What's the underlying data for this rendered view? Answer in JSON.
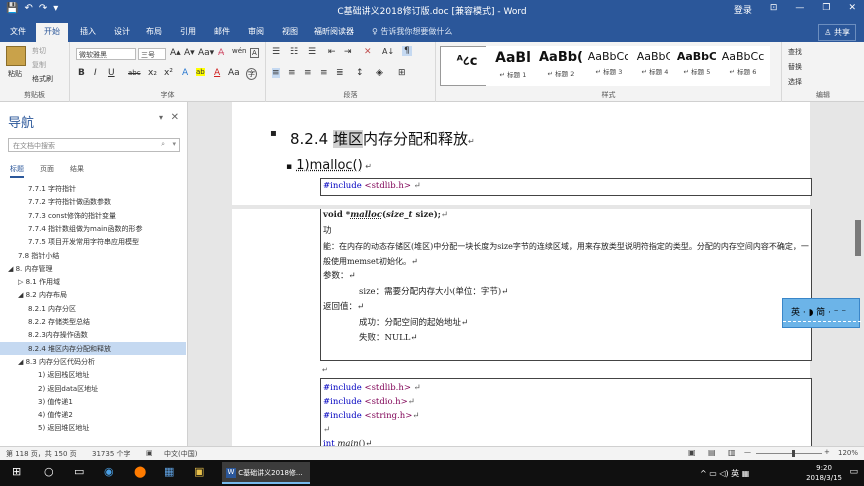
{
  "window": {
    "title": "C基础讲义2018修订版.doc [兼容模式] - Word",
    "login": "登录",
    "controls": {
      "restore_ribbon": "⊡",
      "minimize": "—",
      "maximize": "❐",
      "close": "✕"
    },
    "qat": {
      "save": "💾",
      "undo": "↶",
      "redo": "↷",
      "customize": "▾"
    }
  },
  "ribbon_tabs": [
    "文件",
    "开始",
    "插入",
    "设计",
    "布局",
    "引用",
    "邮件",
    "审阅",
    "视图",
    "福昕阅读器"
  ],
  "active_tab": "开始",
  "tell_me": "♀ 告诉我你想要做什么",
  "share": "♙ 共享",
  "ribbon": {
    "clipboard": {
      "label": "剪贴板",
      "paste": "粘贴",
      "cut": "剪切",
      "copy": "复制",
      "format_painter": "格式刷"
    },
    "font": {
      "label": "字体",
      "font_name": "微软雅黑",
      "font_size": "三号",
      "grow": "A▴",
      "shrink": "A▾",
      "case": "Aa▾",
      "clear": "A̶",
      "wen": "wén",
      "border_a": "A",
      "bold": "B",
      "italic": "I",
      "underline": "U",
      "strike": "abc",
      "sub": "x₂",
      "sup": "x²",
      "effects": "A",
      "highlight": "ab",
      "color": "A",
      "aa": "Aa",
      "circle": "字"
    },
    "paragraph": {
      "label": "段落",
      "bullets": "☰",
      "numbering": "☷",
      "multilevel": "☰",
      "dec_indent": "⇤",
      "inc_indent": "⇥",
      "chinese_layout": "✕",
      "sort": "A↓",
      "marks": "¶",
      "align_left": "≡",
      "center": "≡",
      "align_right": "≡",
      "justify": "≡",
      "distributed": "≣",
      "line_spacing": "↕",
      "shading": "◈",
      "borders": "⊞"
    },
    "styles": {
      "label": "样式",
      "items": [
        {
          "preview": "ᴬ८ᴄ",
          "name": ""
        },
        {
          "preview": "AaBl",
          "name": "↵ 标题 1"
        },
        {
          "preview": "AaBb(",
          "name": "↵ 标题 2"
        },
        {
          "preview": "AaBbCc",
          "name": "↵ 标题 3"
        },
        {
          "preview": "AaBbC",
          "name": "↵ 标题 4"
        },
        {
          "preview": "AaBbC",
          "name": "↵ 标题 5"
        },
        {
          "preview": "AaBbCc",
          "name": "↵ 标题 6"
        }
      ]
    },
    "editing": {
      "label": "编辑",
      "find": "查找",
      "replace": "替换",
      "select": "选择"
    }
  },
  "nav": {
    "title": "导航",
    "search_placeholder": "在文档中搜索",
    "tabs": [
      "标题",
      "页面",
      "结果"
    ],
    "items": [
      {
        "text": "7.7.1 字符指针",
        "indent": 3
      },
      {
        "text": "7.7.2 字符指针做函数参数",
        "indent": 3
      },
      {
        "text": "7.7.3 const修饰的指针变量",
        "indent": 3
      },
      {
        "text": "7.7.4 指针数组做为main函数的形参",
        "indent": 3
      },
      {
        "text": "7.7.5 项目开发常用字符串应用模型",
        "indent": 3
      },
      {
        "text": "7.8 指针小结",
        "indent": 2
      },
      {
        "text": "◢ 8. 内存管理",
        "indent": 1
      },
      {
        "text": "▷ 8.1 作用域",
        "indent": 2
      },
      {
        "text": "◢ 8.2 内存布局",
        "indent": 2
      },
      {
        "text": "8.2.1 内存分区",
        "indent": 3
      },
      {
        "text": "8.2.2 存储类型总结",
        "indent": 3
      },
      {
        "text": "8.2.3内存操作函数",
        "indent": 3
      },
      {
        "text": "8.2.4 堆区内存分配和释放",
        "indent": 3,
        "selected": true
      },
      {
        "text": "◢ 8.3 内存分区代码分析",
        "indent": 2
      },
      {
        "text": "1) 返回栈区地址",
        "indent": 4
      },
      {
        "text": "2) 返回data区地址",
        "indent": 4
      },
      {
        "text": "3) 值传递1",
        "indent": 4
      },
      {
        "text": "4) 值传递2",
        "indent": 4
      },
      {
        "text": "5) 返回堆区地址",
        "indent": 4
      }
    ]
  },
  "document": {
    "heading": {
      "prefix": "8.2.4 ",
      "highlight": "堆区",
      "rest": "内存分配和释放",
      "mark": "↵"
    },
    "sub_heading": {
      "bullet": "▪",
      "text": "1)malloc()",
      "mark": " ↵"
    },
    "include1": {
      "kw": "#include ",
      "file": "<stdlib.h>",
      "mark": " ↵"
    },
    "proto": {
      "void": "void ",
      "star": "*",
      "fn": "malloc",
      "open": "(",
      "type": "size_t",
      "rest": " size);",
      "mark": "↵"
    },
    "gong": "功",
    "desc": "能：在内存的动态存储区(堆区)中分配一块长度为size字节的连续区域，用来存放类型说明符指定的类型。分配的内存空间内容不确定，一般使用memset初始化。↵",
    "params_label": "参数：↵",
    "param_size": "size：需要分配内存大小(单位：字节)↵",
    "ret_label": "返回值：↵",
    "ret_ok": "成功：分配空间的起始地址↵",
    "ret_fail": "失败：NULL↵",
    "blank": "↵",
    "code": [
      {
        "kw": "#include ",
        "file": "<stdlib.h>",
        "mark": " ↵"
      },
      {
        "kw": "#include ",
        "file": "<stdio.h>",
        "mark": "↵"
      },
      {
        "kw": "#include ",
        "file": "<string.h>",
        "mark": "↵"
      },
      {
        "kw": "",
        "file": "",
        "mark": "↵"
      },
      {
        "kw": "int ",
        "file": "main",
        "mark": "()↵"
      }
    ]
  },
  "ime": {
    "text": "英 · ◗ 简 · ⁻ ⁻"
  },
  "status": {
    "page": "第 118 页，共 150 页",
    "words": "31735 个字",
    "proof": "▣",
    "lang": "中文(中国)",
    "zoom": "120%",
    "minus": "—",
    "plus": "+"
  },
  "taskbar": {
    "start": "⊞",
    "search": "○",
    "taskview": "▭",
    "apps": [
      "◉",
      "⬤",
      "▦",
      "▣"
    ],
    "word_label": "C基础讲义2018修...",
    "tray": "^ ▭ ◁) 英 ▦",
    "time": "9:20",
    "date": "2018/3/15",
    "notify": "▭"
  }
}
